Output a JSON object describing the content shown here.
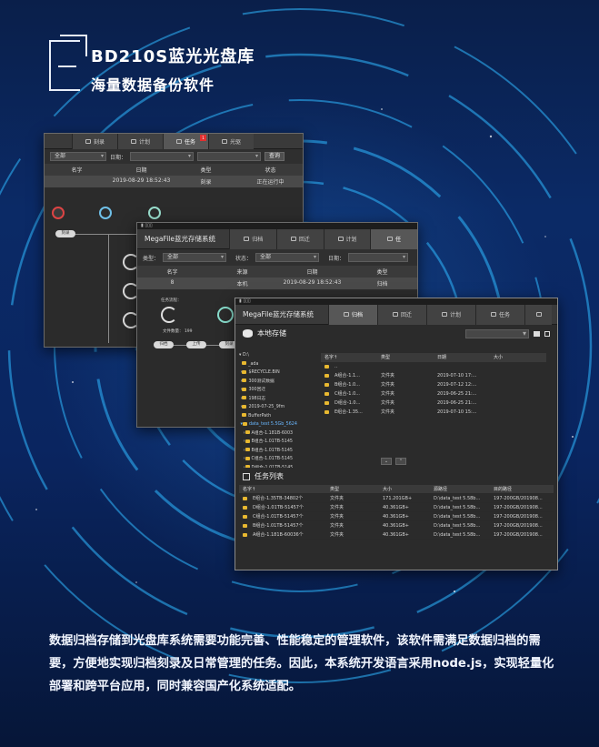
{
  "header": {
    "title": "BD210S蓝光光盘库",
    "subtitle": "海量数据备份软件"
  },
  "win_a": {
    "tabs": [
      "刻录",
      "计划",
      "任务",
      "光驱"
    ],
    "badge": "1",
    "filter": {
      "type_value": "全部",
      "date_label": "日期：",
      "query_label": "查询"
    },
    "columns": [
      "名字",
      "日期",
      "类型",
      "状态"
    ],
    "row": {
      "date": "2019-08-29 18:52:43",
      "type": "刻录",
      "status": "正在运行中"
    },
    "pill_label": "刻录"
  },
  "win_b": {
    "app_name": "MegaFile蓝光存储系统",
    "tabs": [
      "归档",
      "回迁",
      "计划",
      "任"
    ],
    "filter": {
      "type_label": "类型：",
      "type_value": "全部",
      "status_label": "状态：",
      "status_value": "全部",
      "date_label": "日期："
    },
    "columns": [
      "名字",
      "来源",
      "日期",
      "类型"
    ],
    "row": {
      "name": "8",
      "source": "本机",
      "date": "2019-08-29 18:52:43",
      "type": "归档"
    },
    "flow_label": "任务流程：",
    "count_label": "文件数量：",
    "count_value": "199",
    "pills": [
      "归档",
      "上传",
      "刻录"
    ]
  },
  "win_c": {
    "app_name": "MegaFile蓝光存储系统",
    "tabs": [
      "归档",
      "回迁",
      "计划",
      "任务"
    ],
    "local_storage_label": "本地存储",
    "tree": [
      "D:\\",
      "_ada",
      "$RECYCLE.BIN",
      "300测试数据",
      "300回迁",
      "198日志",
      "2019-07-25_9fm",
      "BufferPath",
      "data_test 5.5Gb_5624",
      "A组合-1.181B-6003",
      "B组合-1.01TB-5145",
      "B组合-1.01TB-5145",
      "C组合-1.01TB-5145",
      "D组合-1.01TB-5145"
    ],
    "file_columns": [
      "名字↑",
      "类型",
      "日期",
      "大小"
    ],
    "files": [
      {
        "name": "..",
        "type": "",
        "date": "",
        "size": ""
      },
      {
        "name": "A组合-1.1...",
        "type": "文件夹",
        "date": "2019-07-10 17:...",
        "size": ""
      },
      {
        "name": "B组合-1.0...",
        "type": "文件夹",
        "date": "2019-07-12 12:...",
        "size": ""
      },
      {
        "name": "C组合-1.0...",
        "type": "文件夹",
        "date": "2019-06-25 21:...",
        "size": ""
      },
      {
        "name": "D组合-1.0...",
        "type": "文件夹",
        "date": "2019-06-25 21:...",
        "size": ""
      },
      {
        "name": "E组合-1.35...",
        "type": "文件夹",
        "date": "2019-07-10 15:...",
        "size": ""
      }
    ],
    "task_label": "任务列表",
    "task_columns": [
      "名字↑",
      "类型",
      "大小",
      "源路径",
      "目的路径"
    ],
    "tasks": [
      {
        "name": "E组合-1.35TB-34802个",
        "type": "文件夹",
        "size": "171.201GB+",
        "src": "D:\\data_test 5.58b...",
        "dst": "197-200GB/201908..."
      },
      {
        "name": "D组合-1.01TB-51457个",
        "type": "文件夹",
        "size": "40.361GB+",
        "src": "D:\\data_test 5.58b...",
        "dst": "197-200GB/201908..."
      },
      {
        "name": "C组合-1.01TB-51457个",
        "type": "文件夹",
        "size": "40.361GB+",
        "src": "D:\\data_test 5.58b...",
        "dst": "197-200GB/201908..."
      },
      {
        "name": "B组合-1.01TB-51457个",
        "type": "文件夹",
        "size": "40.361GB+",
        "src": "D:\\data_test 5.58b...",
        "dst": "197-200GB/201908..."
      },
      {
        "name": "A组合-1.181B-60036个",
        "type": "文件夹",
        "size": "40.361GB+",
        "src": "D:\\data_test 5.58b...",
        "dst": "197-200GB/201908..."
      }
    ]
  },
  "description": "数据归档存储到光盘库系统需要功能完善、性能稳定的管理软件，该软件需满足数据归档的需要，方便地实现归档刻录及日常管理的任务。因此，本系统开发语言采用node.js，实现轻量化部署和跨平台应用，同时兼容国产化系统适配。",
  "colors": {
    "accent": "#1e90ff",
    "folder": "#e8b830",
    "window_bg": "#2b2b2b",
    "ring": "#2fb8ff"
  }
}
